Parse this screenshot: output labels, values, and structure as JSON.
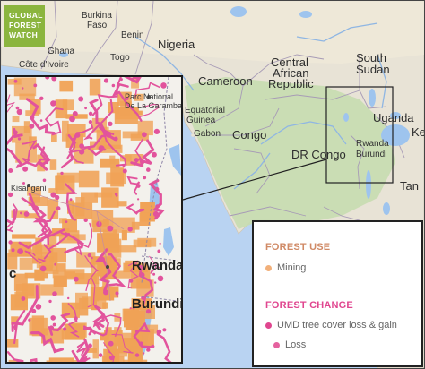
{
  "logo": {
    "line1": "GLOBAL",
    "line2": "FOREST",
    "line3": "WATCH"
  },
  "map_labels": {
    "burkina_faso_1": "Burkina",
    "burkina_faso_2": "Faso",
    "benin": "Benin",
    "ghana": "Ghana",
    "togo": "Togo",
    "cote_divoire": "Côte d'Ivoire",
    "nigeria": "Nigeria",
    "cameroon": "Cameroon",
    "car_1": "Central",
    "car_2": "African",
    "car_3": "Republic",
    "south_sudan_1": "South",
    "south_sudan_2": "Sudan",
    "eq_guinea_1": "Equatorial",
    "eq_guinea_2": "Guinea",
    "gabon": "Gabon",
    "congo": "Congo",
    "dr_congo": "DR Congo",
    "uganda": "Uganda",
    "rwanda": "Rwanda",
    "burundi": "Burundi",
    "kenya": "Ke",
    "tanzania": "Tan"
  },
  "inset_labels": {
    "parc_1": "Parc National",
    "parc_2": "De La Garamba",
    "kisangani": "Kisangani",
    "rwanda": "Rwanda",
    "burundi": "Burundi",
    "edge_c": "c"
  },
  "legend": {
    "forest_use_title": "FOREST USE",
    "mining_label": "Mining",
    "forest_change_title": "FOREST CHANGE",
    "umd_label": "UMD tree cover loss & gain",
    "loss_label": "Loss"
  },
  "colors": {
    "forest_use_title": "#d08a66",
    "mining_dot": "#f2b07a",
    "forest_change_title": "#e0468f",
    "umd_dot": "#e0468f",
    "loss_dot": "#e5629f",
    "mining_fill": "#f0a256",
    "loss_fill": "#e2539c",
    "land": "#e8e3d6",
    "forest_land": "#c7dcb0",
    "water": "#b9d3f2",
    "logo": "#8bb53e"
  }
}
